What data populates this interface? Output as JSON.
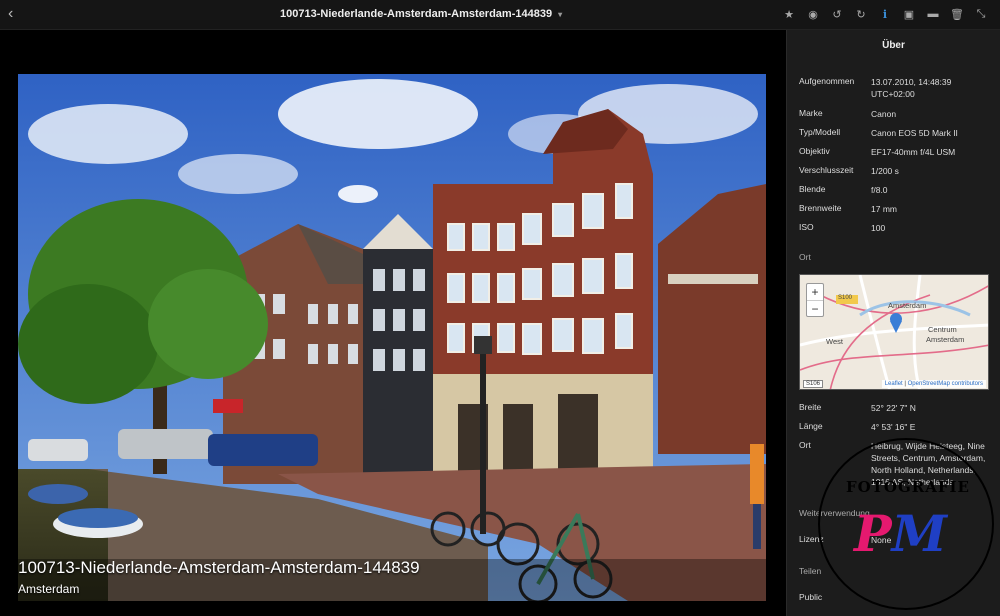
{
  "title": "100713-Niederlande-Amsterdam-Amsterdam-144839",
  "toolbar": [
    "star-icon",
    "eye-icon",
    "rotate-left-icon",
    "rotate-right-icon",
    "info-icon",
    "image-icon",
    "folder-icon",
    "trash-icon",
    "fullscreen-icon"
  ],
  "caption": {
    "title": "100713-Niederlande-Amsterdam-Amsterdam-144839",
    "subtitle": "Amsterdam"
  },
  "panel": {
    "heading": "Über",
    "taken_label": "Aufgenommen",
    "taken_value": "13.07.2010, 14:48:39 UTC+02:00",
    "make_label": "Marke",
    "make_value": "Canon",
    "model_label": "Typ/Modell",
    "model_value": "Canon EOS 5D Mark II",
    "lens_label": "Objektiv",
    "lens_value": "EF17-40mm f/4L USM",
    "shutter_label": "Verschlusszeit",
    "shutter_value": "1/200 s",
    "aperture_label": "Blende",
    "aperture_value": "f/8.0",
    "focal_label": "Brennweite",
    "focal_value": "17 mm",
    "iso_label": "ISO",
    "iso_value": "100",
    "location_section": "Ort",
    "lat_label": "Breite",
    "lat_value": "52° 22' 7\" N",
    "lon_label": "Länge",
    "lon_value": "4° 53' 16\" E",
    "place_label": "Ort",
    "place_value": "Heibrug, Wijde Heisteeg, Nine Streets, Centrum, Amsterdam, North Holland, Netherlands, 1016 AS, Netherlands",
    "reuse_section": "Weiterverwendung",
    "license_label": "Lizenz",
    "license_value": "None",
    "share_section": "Teilen",
    "public_label": "Public"
  },
  "map": {
    "city": "Amsterdam",
    "district": "Centrum",
    "district2": "Amsterdam",
    "west": "West",
    "road": "S100",
    "scale": "S106",
    "attr_leaflet": "Leaflet",
    "attr_osm": "OpenStreetMap contributors"
  },
  "watermark": {
    "text": "FOTOGRAFIE",
    "logo_p": "P",
    "logo_m": "M"
  }
}
